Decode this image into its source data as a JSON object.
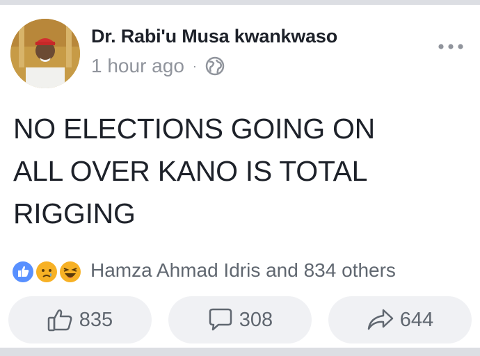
{
  "post": {
    "author": "Dr. Rabi'u Musa kwankwaso",
    "time": "1 hour ago",
    "separator": "·",
    "privacy_icon": "globe-icon",
    "menu_icon": "more-options-icon",
    "text": "NO ELECTIONS GOING ON\nALL OVER KANO IS TOTAL\nRIGGING"
  },
  "reactions": {
    "icons": [
      "like-reaction-icon",
      "sad-reaction-icon",
      "haha-reaction-icon"
    ],
    "summary": "Hamza Ahmad Idris and 834 others"
  },
  "actions": {
    "like_count": "835",
    "comment_count": "308",
    "share_count": "644",
    "like_icon": "thumbs-up-icon",
    "comment_icon": "comment-bubble-icon",
    "share_icon": "share-arrow-icon"
  },
  "colors": {
    "like_blue": "#5890ff",
    "reaction_yellow": "#f7b125",
    "text_primary": "#1d2129",
    "text_secondary": "#90949c",
    "button_bg": "#f0f1f4"
  }
}
